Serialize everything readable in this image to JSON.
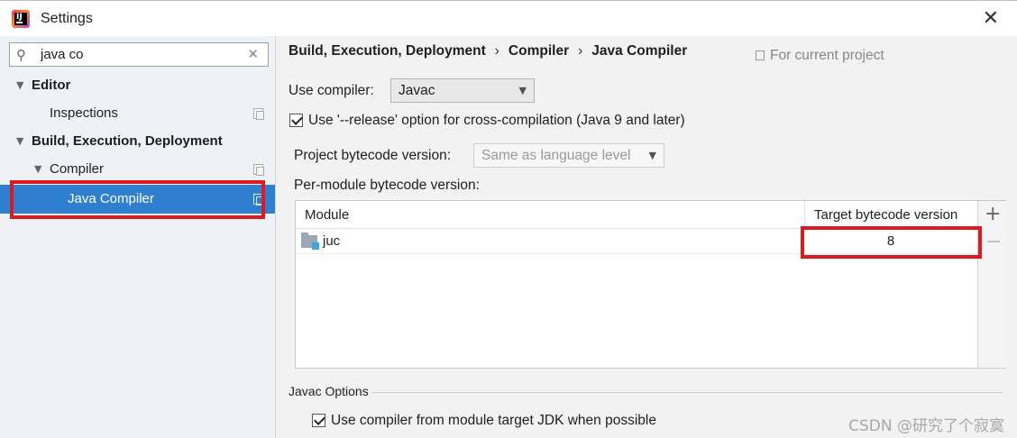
{
  "window": {
    "title": "Settings",
    "app_icon_letter": "IJ",
    "close_icon": "close-icon"
  },
  "sidebar": {
    "search": {
      "value": "java co",
      "search_icon": "search-icon",
      "clear_icon": "clear-icon"
    },
    "items": [
      {
        "label": "Editor",
        "expanded": true,
        "bold": true
      },
      {
        "label": "Inspections"
      },
      {
        "label": "Build, Execution, Deployment",
        "expanded": true,
        "bold": true
      },
      {
        "label": "Compiler",
        "expanded": true
      },
      {
        "label": "Java Compiler",
        "selected": true
      }
    ]
  },
  "breadcrumb": {
    "items": [
      "Build, Execution, Deployment",
      "Compiler",
      "Java Compiler"
    ],
    "separator": "›",
    "scope_label": "For current project"
  },
  "compiler": {
    "use_compiler_label": "Use compiler:",
    "use_compiler_value": "Javac",
    "release_option_label": "Use '--release' option for cross-compilation (Java 9 and later)",
    "release_option_checked": true,
    "project_bytecode_label": "Project bytecode version:",
    "project_bytecode_value": "Same as language level",
    "per_module_label": "Per-module bytecode version:"
  },
  "module_table": {
    "columns": [
      "Module",
      "Target bytecode version"
    ],
    "rows": [
      {
        "module": "juc",
        "target": "8"
      }
    ],
    "add_label": "+",
    "remove_label": "−"
  },
  "javac_options": {
    "group_title": "Javac Options",
    "module_target_jdk_label": "Use compiler from module target JDK when possible",
    "module_target_jdk_checked": true
  },
  "watermark": "CSDN @研究了个寂寞",
  "colors": {
    "selection": "#2f7fd1",
    "highlight_box": "#e0191f"
  }
}
